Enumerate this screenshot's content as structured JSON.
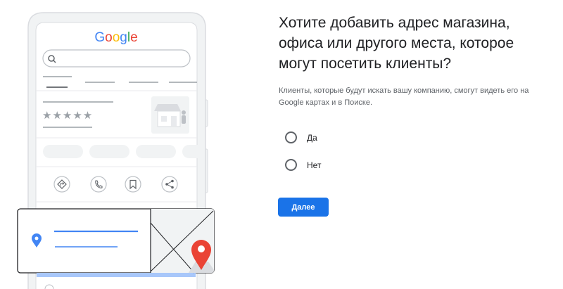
{
  "illustration": {
    "logo_text": "Google",
    "logo_colors": [
      "#4285F4",
      "#EA4335",
      "#FBBC05",
      "#4285F4",
      "#34A853",
      "#EA4335"
    ],
    "rating_stars": "★★★★★",
    "action_icons": [
      "directions-icon",
      "phone-icon",
      "bookmark-icon",
      "share-icon"
    ],
    "pin_colors": {
      "blue": "#4285F4",
      "red": "#EA4335"
    }
  },
  "main": {
    "question": "Хотите добавить адрес магазина, офиса или другого места, которое могут посетить клиенты?",
    "description": "Клиенты, которые будут искать вашу компанию, смогут видеть его на Google картах и в Поиске.",
    "options": [
      {
        "label": "Да",
        "selected": false
      },
      {
        "label": "Нет",
        "selected": false
      }
    ],
    "next_button": "Далее"
  },
  "colors": {
    "accent": "#1a73e8"
  }
}
